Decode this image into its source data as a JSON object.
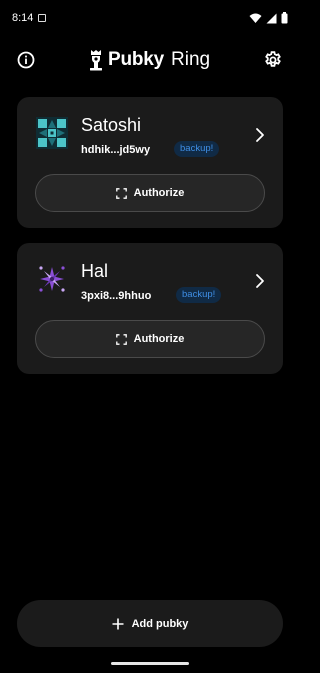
{
  "status_bar": {
    "time": "8:14",
    "icons": [
      "notification-icon",
      "wifi-icon",
      "signal-icon",
      "battery-icon"
    ]
  },
  "header": {
    "logo_name": "Pubky",
    "logo_suffix": "Ring",
    "left_icon": "info-icon",
    "right_icon": "gear-icon"
  },
  "accounts": [
    {
      "name": "Satoshi",
      "key": "hdhik...jd5wy",
      "badge": "backup!",
      "action_label": "Authorize",
      "avatar_colors": [
        "#4cc4c8",
        "#1e6f78",
        "#0f2c33"
      ]
    },
    {
      "name": "Hal",
      "key": "3pxi8...9hhuo",
      "badge": "backup!",
      "action_label": "Authorize",
      "avatar_colors": [
        "#8b4fd6",
        "#c9a7f5",
        "#3b1f66"
      ]
    }
  ],
  "footer": {
    "add_label": "Add pubky"
  },
  "colors": {
    "background": "#000000",
    "card": "#1b1b1b",
    "badge_text": "#3f8ee4",
    "badge_bg": "#102a45"
  }
}
